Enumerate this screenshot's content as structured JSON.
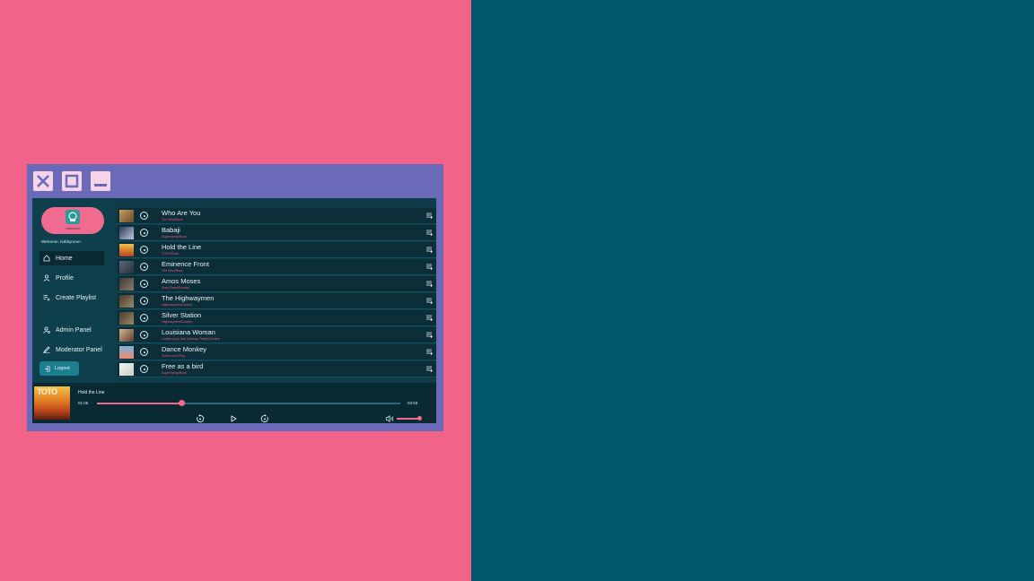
{
  "colors": {
    "left_background": "#f2638a",
    "right_background": "#01586b",
    "window_frame": "#6a6ab8",
    "accent": "#f06b8f",
    "app_background": "#0e3c48"
  },
  "window_controls": [
    {
      "name": "close-button",
      "icon": "close-icon"
    },
    {
      "name": "maximize-button",
      "icon": "maximize-icon"
    },
    {
      "name": "minimize-button",
      "icon": "minimize-icon"
    }
  ],
  "sidebar": {
    "logo_text": "harmonii",
    "welcome": "Welcome, bobbyrune!",
    "nav": [
      {
        "label": "Home",
        "icon": "home-icon",
        "active": true
      },
      {
        "label": "Profile",
        "icon": "user-icon",
        "active": false
      },
      {
        "label": "Create Playlist",
        "icon": "playlist-add-icon",
        "active": false
      },
      {
        "label": "Admin Panel",
        "icon": "admin-icon",
        "active": false
      },
      {
        "label": "Moderator Panel",
        "icon": "edit-icon",
        "active": false
      }
    ],
    "logout_label": "Logout"
  },
  "tracks": [
    {
      "title": "Who Are You",
      "artist": "The Who/Rock"
    },
    {
      "title": "Babaji",
      "artist": "Supertramp/Rock"
    },
    {
      "title": "Hold the Line",
      "artist": "TOTO/Rock"
    },
    {
      "title": "Eminence Front",
      "artist": "The Who/Rock"
    },
    {
      "title": "Amos Moses",
      "artist": "Jerry Reed/Country"
    },
    {
      "title": "The Highwaymen",
      "artist": "Highwaymen/Country"
    },
    {
      "title": "Silver Station",
      "artist": "Highwaymen/Country"
    },
    {
      "title": "Louisiana Woman",
      "artist": "Loretta Lynn and Conway Twitty/Country"
    },
    {
      "title": "Dance Monkey",
      "artist": "Tones and I/Pop"
    },
    {
      "title": "Free as a bird",
      "artist": "Supertramp/Rock"
    }
  ],
  "player": {
    "now_playing": "Hold the Line",
    "cover_text": "TOTO",
    "current_time": "01:06",
    "total_time": "03:58",
    "progress": 0.28,
    "volume": 1.0
  }
}
